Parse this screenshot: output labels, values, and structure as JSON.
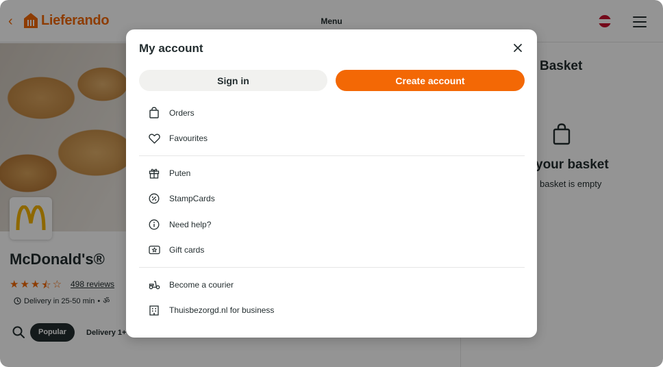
{
  "header": {
    "brand": "Lieferando",
    "title": "Menu"
  },
  "restaurant": {
    "name": "McDonald's®",
    "rating_stars": 3.5,
    "reviews": "498 reviews",
    "delivery": "Delivery in 25-50 min"
  },
  "categories": {
    "popular": "Popular",
    "delivery": "Delivery 1+"
  },
  "basket": {
    "title": "Basket",
    "heading": "your basket",
    "empty": "basket is empty"
  },
  "modal": {
    "title": "My account",
    "sign_in": "Sign in",
    "create_account": "Create account",
    "group1": [
      {
        "label": "Orders",
        "icon": "bag-icon"
      },
      {
        "label": "Favourites",
        "icon": "heart-icon"
      }
    ],
    "group2": [
      {
        "label": "Puten",
        "icon": "gift-icon"
      },
      {
        "label": "StampCards",
        "icon": "stamp-icon"
      },
      {
        "label": "Need help?",
        "icon": "info-icon"
      },
      {
        "label": "Gift cards",
        "icon": "gift-card-icon"
      }
    ],
    "group3": [
      {
        "label": "Become a courier",
        "icon": "scooter-icon"
      },
      {
        "label": "Thuisbezorgd.nl for business",
        "icon": "building-icon"
      }
    ]
  },
  "colors": {
    "brand": "#f36805",
    "text": "#242e30",
    "secondary_button": "#f1f1ef"
  }
}
